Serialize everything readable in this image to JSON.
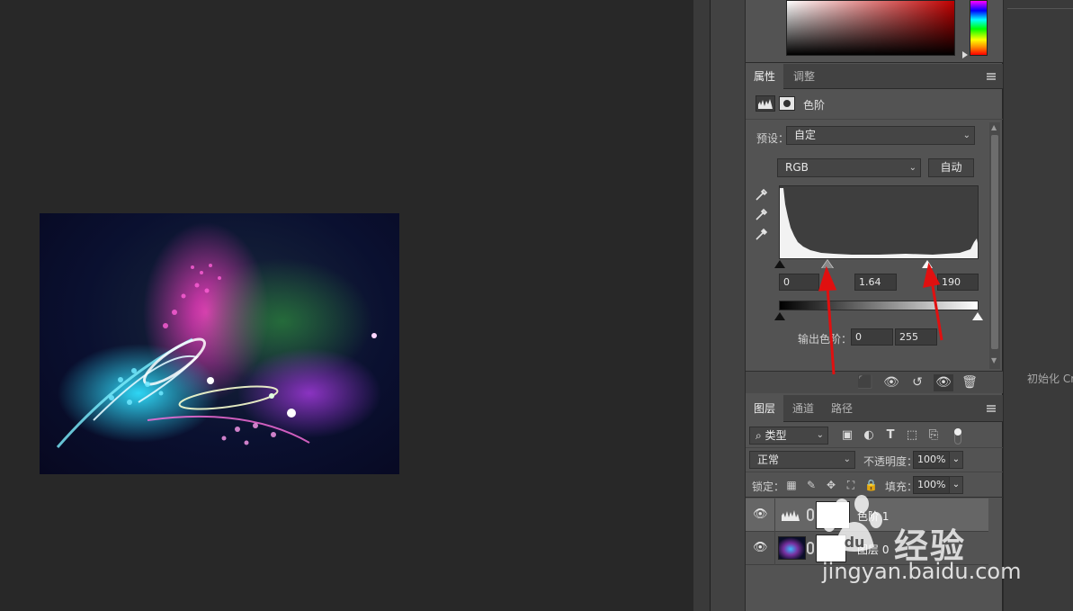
{
  "color_panel": {
    "accent_hue": "#c00000"
  },
  "properties": {
    "tabs": [
      {
        "label": "属性",
        "active": true
      },
      {
        "label": "调整",
        "active": false
      }
    ],
    "adjustment_title": "色阶",
    "preset_label": "预设：",
    "preset_value": "自定",
    "channel_value": "RGB",
    "auto_button": "自动",
    "input_black": "0",
    "input_gamma": "1.64",
    "input_white": "190",
    "output_label": "输出色阶：",
    "output_black": "0",
    "output_white": "255"
  },
  "layers": {
    "tabs": [
      {
        "label": "图层",
        "active": true
      },
      {
        "label": "通道",
        "active": false
      },
      {
        "label": "路径",
        "active": false
      }
    ],
    "filter_kind": "类型",
    "blend_mode": "正常",
    "opacity_label": "不透明度：",
    "opacity_value": "100%",
    "lock_label": "锁定：",
    "fill_label": "填充：",
    "fill_value": "100%",
    "rows": [
      {
        "name": "色阶 1",
        "type": "adjustment",
        "visible": true,
        "selected": true
      },
      {
        "name": "图层 0",
        "type": "image",
        "visible": true,
        "selected": false
      }
    ]
  },
  "side_panel": {
    "init_text": "初始化 Cr"
  },
  "watermark": {
    "brand": "经验",
    "url": "jingyan.baidu.com"
  },
  "annotations": {
    "arrow_color": "#e01010"
  }
}
